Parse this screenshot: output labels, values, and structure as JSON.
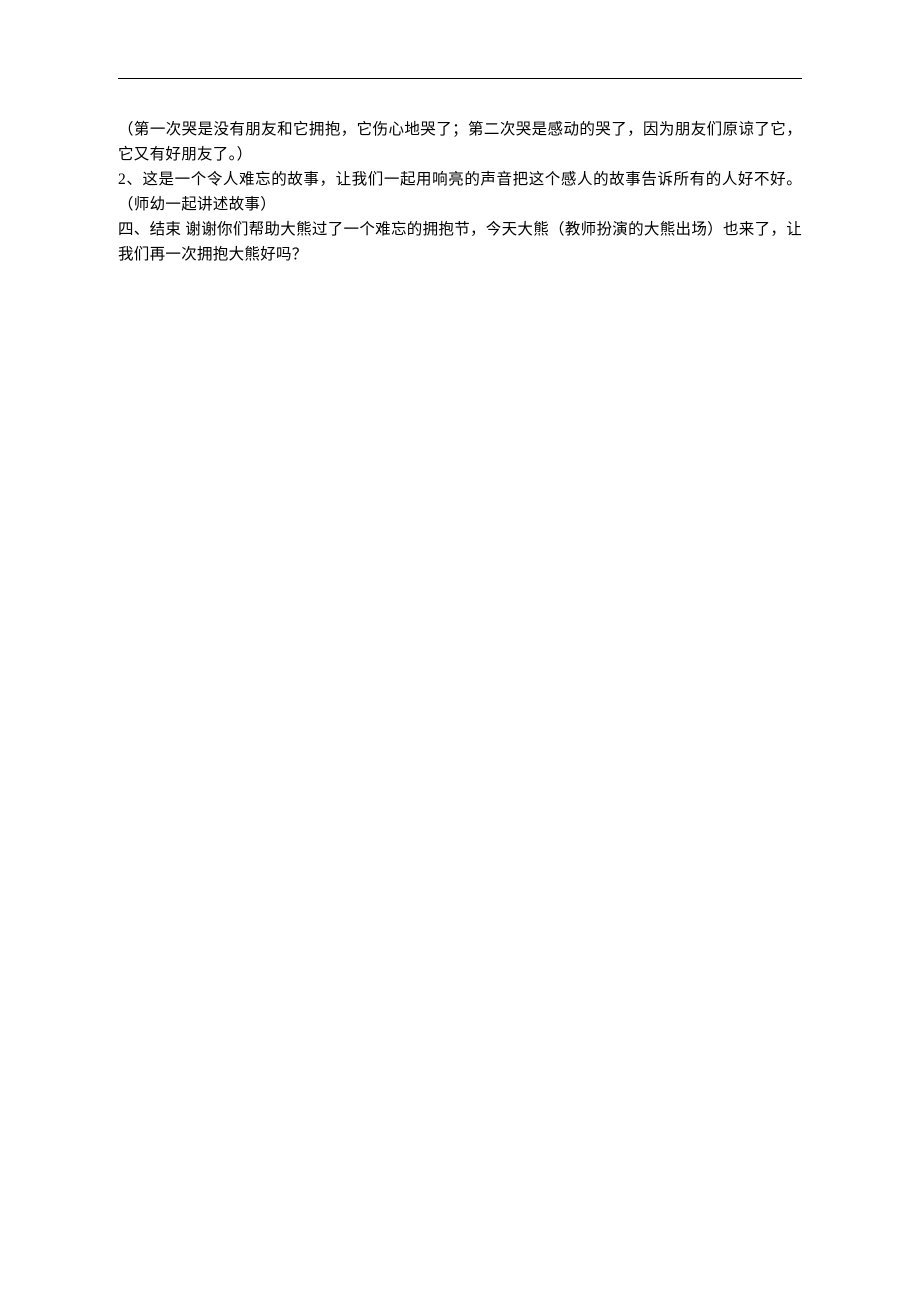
{
  "paragraphs": [
    "（第一次哭是没有朋友和它拥抱，它伤心地哭了；第二次哭是感动的哭了，因为朋友们原谅了它，它又有好朋友了。）",
    "2、这是一个令人难忘的故事，让我们一起用响亮的声音把这个感人的故事告诉所有的人好不好。（师幼一起讲述故事）",
    "四、结束  谢谢你们帮助大熊过了一个难忘的拥抱节，今天大熊（教师扮演的大熊出场）也来了，让我们再一次拥抱大熊好吗？"
  ]
}
